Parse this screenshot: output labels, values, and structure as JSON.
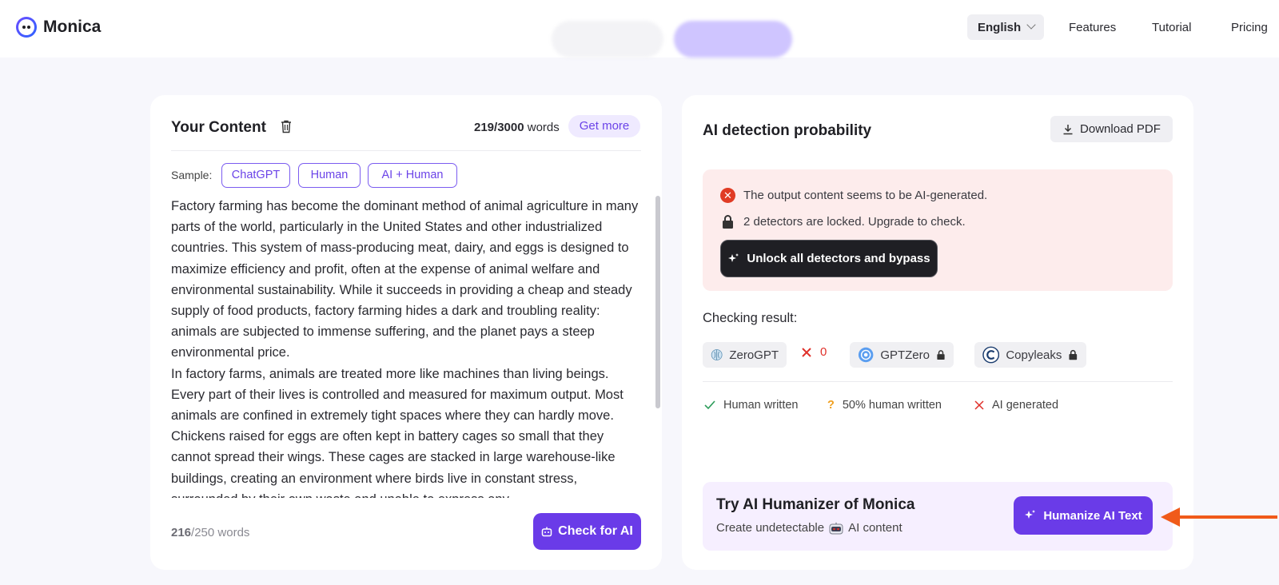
{
  "header": {
    "brand": "Monica",
    "language": "English",
    "nav": [
      "Features",
      "Tutorial",
      "Pricing"
    ]
  },
  "content_panel": {
    "title": "Your Content",
    "word_count": "219/3000",
    "word_unit": "words",
    "get_more": "Get more",
    "sample_label": "Sample:",
    "samples": [
      "ChatGPT",
      "Human",
      "AI + Human"
    ],
    "text_paragraphs": [
      "Factory farming has become the dominant method of animal agriculture in many parts of the world, particularly in the United States and other industrialized countries. This system of mass-producing meat, dairy, and eggs is designed to maximize efficiency and profit, often at the expense of animal welfare and environmental sustainability. While it succeeds in providing a cheap and steady supply of food products, factory farming hides a dark and troubling reality: animals are subjected to immense suffering, and the planet pays a steep environmental price.",
      "In factory farms, animals are treated more like machines than living beings. Every part of their lives is controlled and measured for maximum output. Most animals are confined in extremely tight spaces where they can hardly move. Chickens raised for eggs are often kept in battery cages so small that they cannot spread their wings. These cages are stacked in large warehouse-like buildings, creating an environment where birds live in constant stress, surrounded by their own waste and unable to express any"
    ],
    "limit_used": "216",
    "limit_total": "/250 words",
    "check_button": "Check for AI"
  },
  "result_panel": {
    "title": "AI detection probability",
    "download": "Download PDF",
    "alert_message": "The output content seems to be AI-generated.",
    "locked_message": "2 detectors are locked. Upgrade to check.",
    "unlock_button": "Unlock all detectors and bypass",
    "checking_label": "Checking result:",
    "detectors": [
      {
        "name": "ZeroGPT",
        "result": "0",
        "icon": "zerogpt-brain-icon"
      },
      {
        "name": "GPTZero",
        "icon": "gptzero-logo-icon",
        "locked": true
      },
      {
        "name": "Copyleaks",
        "icon": "copyleaks-logo-icon",
        "locked": true
      }
    ],
    "legend": [
      "Human written",
      "50% human written",
      "AI generated"
    ],
    "promo_title": "Try AI Humanizer of Monica",
    "promo_sub_before": "Create undetectable",
    "promo_sub_after": "AI content",
    "humanize_button": "Humanize AI Text"
  },
  "colors": {
    "accent": "#6a3be8",
    "alert_bg": "#fdecec",
    "error": "#e03b24",
    "pointer_arrow": "#f05a1a"
  }
}
